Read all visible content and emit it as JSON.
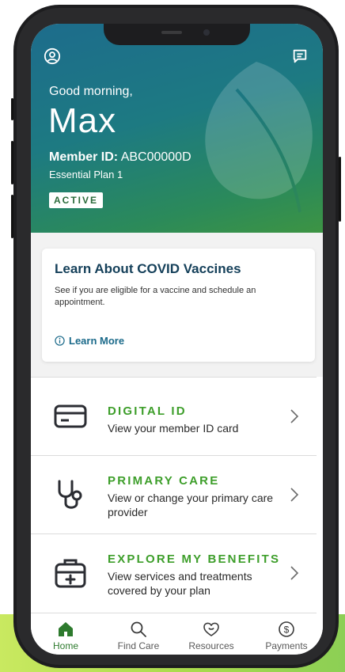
{
  "hero": {
    "greeting": "Good morning,",
    "name": "Max",
    "member_id_label": "Member ID:",
    "member_id_value": "ABC00000D",
    "plan": "Essential Plan 1",
    "status": "ACTIVE",
    "icons": {
      "profile": "profile-icon",
      "messages": "message-icon"
    }
  },
  "covid_card": {
    "title": "Learn About COVID Vaccines",
    "description": "See if you are eligible for a vaccine and schedule an appointment.",
    "link_label": "Learn More",
    "link_icon": "info-icon"
  },
  "menu": {
    "items": [
      {
        "title": "DIGITAL ID",
        "description": "View your member ID card",
        "icon": "id-card-icon"
      },
      {
        "title": "PRIMARY CARE",
        "description": "View or change your primary care provider",
        "icon": "stethoscope-icon"
      },
      {
        "title": "EXPLORE MY BENEFITS",
        "description": "View services and treatments covered by your plan",
        "icon": "medical-kit-icon"
      }
    ]
  },
  "tabbar": {
    "tabs": [
      {
        "label": "Home",
        "icon": "home-icon",
        "active": true
      },
      {
        "label": "Find Care",
        "icon": "search-icon",
        "active": false
      },
      {
        "label": "Resources",
        "icon": "heart-hands-icon",
        "active": false
      },
      {
        "label": "Payments",
        "icon": "dollar-icon",
        "active": false
      }
    ]
  },
  "colors": {
    "accent_green": "#3d9e2a",
    "active_tab_green": "#2d7a2d",
    "link_blue": "#1b6a8a",
    "card_title_navy": "#15405a",
    "hero_gradient": [
      "#1d6c8c",
      "#3d9443"
    ],
    "page_accent": "#a9da4c"
  }
}
